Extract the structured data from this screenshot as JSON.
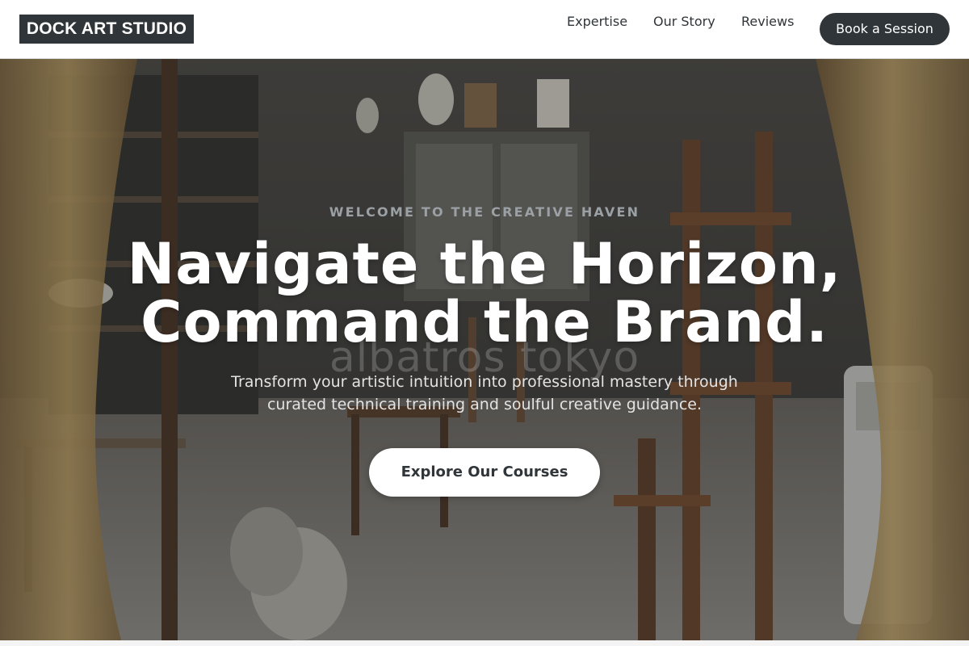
{
  "header": {
    "brand": "DOCK ART STUDIO",
    "nav": [
      {
        "label": "Expertise"
      },
      {
        "label": "Our Story"
      },
      {
        "label": "Reviews"
      }
    ],
    "cta_label": "Book a Session"
  },
  "hero": {
    "eyebrow": "WELCOME TO THE CREATIVE HAVEN",
    "headline_line1": "Navigate the Horizon,",
    "headline_line2": "Command the Brand.",
    "subtext_line1": "Transform your artistic intuition into professional mastery through",
    "subtext_line2": "curated technical training and soulful creative guidance.",
    "cta_label": "Explore Our Courses",
    "watermark": "albatros tokyo",
    "image_icon": "art-studio-photo-icon"
  },
  "colors": {
    "primary_dark": "#2f3538",
    "white": "#ffffff",
    "eyebrow": "#9aa0a4",
    "subtext": "#e3e3e3"
  }
}
